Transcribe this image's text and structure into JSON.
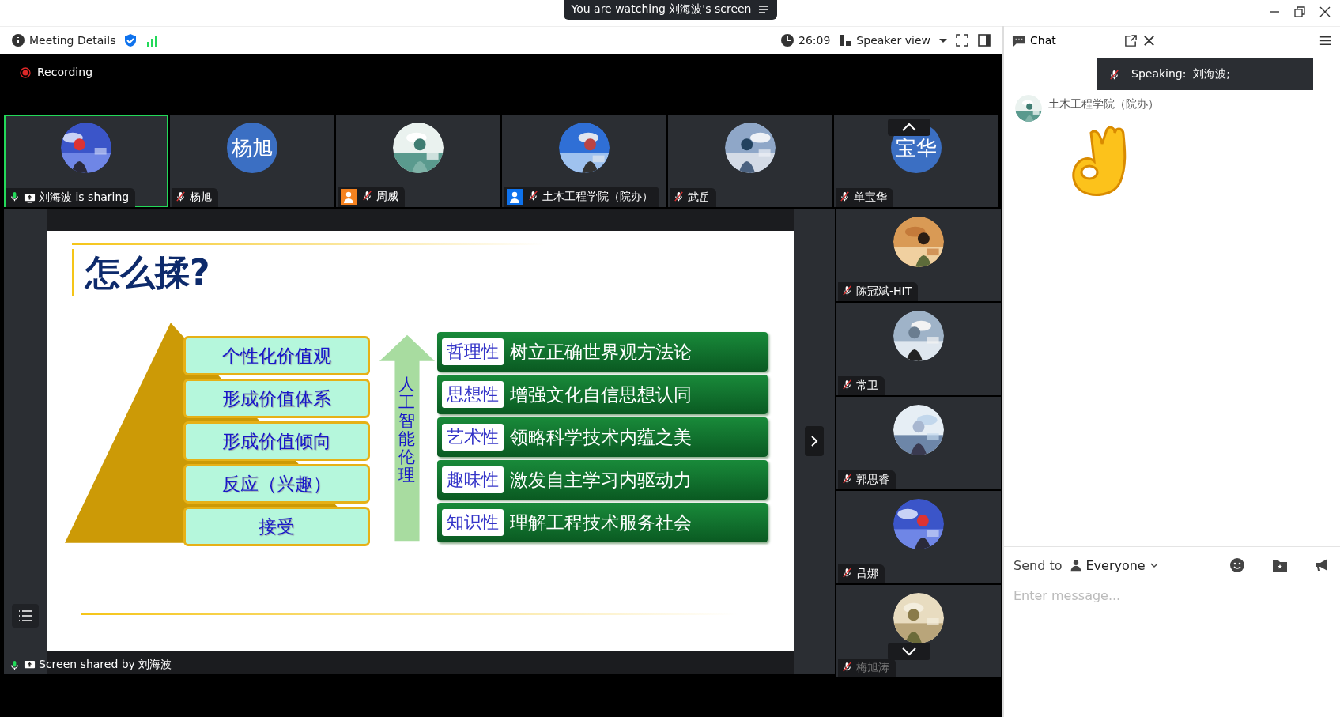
{
  "title_bar": {
    "notice": "You are watching 刘海波's screen"
  },
  "toolbar": {
    "meeting_details": "Meeting Details",
    "timer": "26:09",
    "view": "Speaker view"
  },
  "recording": {
    "label": "Recording"
  },
  "participants": [
    {
      "name": "刘海波 is sharing",
      "muted": false,
      "sharing": true,
      "active": true
    },
    {
      "name": "杨旭",
      "muted": true,
      "sharing": false,
      "active": false,
      "avatar": {
        "kind": "initials",
        "text": "杨旭"
      }
    },
    {
      "name": "周威",
      "muted": true,
      "sharing": false,
      "active": false,
      "color": "#f5821f"
    },
    {
      "name": "土木工程学院（院办）",
      "muted": true,
      "sharing": false,
      "active": false,
      "color": "#0e72ed"
    },
    {
      "name": "武岳",
      "muted": true,
      "sharing": false,
      "active": false
    },
    {
      "name": "单宝华",
      "muted": true,
      "sharing": false,
      "active": false,
      "avatar": {
        "kind": "initials",
        "text": "宝华"
      }
    },
    {
      "name": "陈冠斌-HIT",
      "muted": true,
      "sharing": false,
      "active": false
    },
    {
      "name": "常卫",
      "muted": true,
      "sharing": false,
      "active": false
    },
    {
      "name": "郭思睿",
      "muted": true,
      "sharing": false,
      "active": false
    },
    {
      "name": "吕娜",
      "muted": true,
      "sharing": false,
      "active": false
    },
    {
      "name": "梅旭涛",
      "muted": true,
      "sharing": false,
      "active": false
    }
  ],
  "slide": {
    "title": "怎么揉?",
    "levels": [
      "个性化价值观",
      "形成价值体系",
      "形成价值倾向",
      "反应（兴趣）",
      "接受"
    ],
    "arrow_label": "人工智能伦理",
    "rows": [
      {
        "tag": "哲理性",
        "text": "树立正确世界观方法论"
      },
      {
        "tag": "思想性",
        "text": "增强文化自信思想认同"
      },
      {
        "tag": "艺术性",
        "text": "领略科学技术内蕴之美"
      },
      {
        "tag": "趣味性",
        "text": "激发自主学习内驱动力"
      },
      {
        "tag": "知识性",
        "text": "理解工程技术服务社会"
      }
    ]
  },
  "share_label": "Screen shared by 刘海波",
  "chat": {
    "title": "Chat",
    "speaking": "Speaking:  刘海波;",
    "messages": [
      {
        "sender": "土木工程学院（院办）"
      }
    ],
    "send_to_label": "Send to",
    "recipient": "Everyone",
    "input": {
      "placeholder": "Enter message..."
    }
  }
}
